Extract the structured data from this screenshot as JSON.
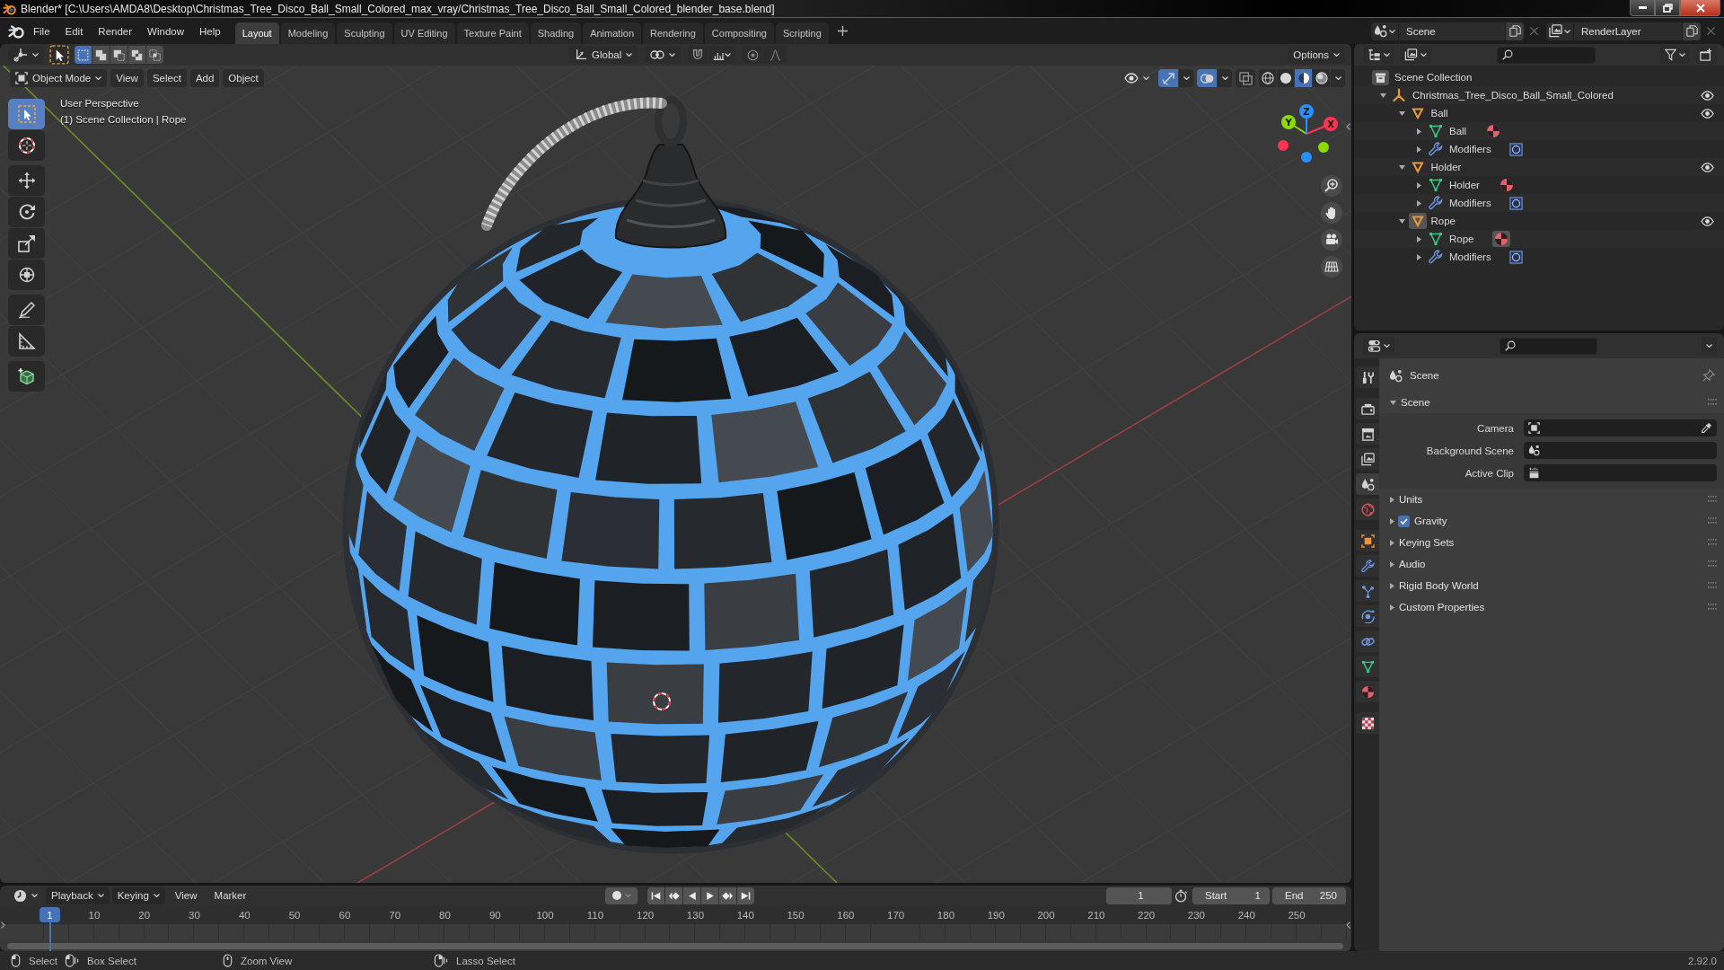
{
  "window": {
    "title": "Blender* [C:\\Users\\AMDA8\\Desktop\\Christmas_Tree_Disco_Ball_Small_Colored_max_vray/Christmas_Tree_Disco_Ball_Small_Colored_blender_base.blend]"
  },
  "menu": [
    "File",
    "Edit",
    "Render",
    "Window",
    "Help"
  ],
  "workspaces": [
    {
      "label": "Layout",
      "selected": true
    },
    {
      "label": "Modeling",
      "selected": false
    },
    {
      "label": "Sculpting",
      "selected": false
    },
    {
      "label": "UV Editing",
      "selected": false
    },
    {
      "label": "Texture Paint",
      "selected": false
    },
    {
      "label": "Shading",
      "selected": false
    },
    {
      "label": "Animation",
      "selected": false
    },
    {
      "label": "Rendering",
      "selected": false
    },
    {
      "label": "Compositing",
      "selected": false
    },
    {
      "label": "Scripting",
      "selected": false
    }
  ],
  "scene": {
    "value": "Scene"
  },
  "view_layer": {
    "value": "RenderLayer"
  },
  "tool_header": {
    "select_modes": [
      {
        "kind": "new",
        "selected": true
      },
      {
        "kind": "extend",
        "selected": false
      },
      {
        "kind": "subtract",
        "selected": false
      },
      {
        "kind": "invert",
        "selected": false
      },
      {
        "kind": "intersect",
        "selected": false
      }
    ],
    "orientation": "Global",
    "options": "Options"
  },
  "viewport": {
    "mode": "Object Mode",
    "menus": [
      "View",
      "Select",
      "Add",
      "Object"
    ],
    "toggles": [
      {
        "kind": "gizmos",
        "on": true
      },
      {
        "kind": "overlays",
        "on": true
      },
      {
        "kind": "xray",
        "on": false
      }
    ],
    "shading": [
      {
        "kind": "wireframe",
        "selected": false
      },
      {
        "kind": "solid",
        "selected": false
      },
      {
        "kind": "material",
        "selected": true
      },
      {
        "kind": "rendered",
        "selected": false
      }
    ],
    "info": [
      "User Perspective",
      "(1) Scene Collection | Rope"
    ],
    "tool_groups": [
      {
        "tools": [
          {
            "kind": "select-box",
            "selected": true
          },
          {
            "kind": "cursor",
            "selected": false
          }
        ]
      },
      {
        "tools": [
          {
            "kind": "move",
            "selected": false
          },
          {
            "kind": "rotate",
            "selected": false
          },
          {
            "kind": "scale",
            "selected": false
          },
          {
            "kind": "transform",
            "selected": false
          }
        ]
      },
      {
        "tools": [
          {
            "kind": "annotate",
            "selected": false
          },
          {
            "kind": "measure",
            "selected": false
          }
        ]
      },
      {
        "tools": [
          {
            "kind": "add-cube",
            "selected": false
          }
        ]
      }
    ],
    "gizmo_axes": [
      {
        "label": "X",
        "color": "#ff3352"
      },
      {
        "label": "Y",
        "color": "#8bdc00"
      },
      {
        "label": "Z",
        "color": "#2890ff"
      }
    ]
  },
  "outliner": {
    "root": "Scene Collection",
    "tree": [
      {
        "label": "Christmas_Tree_Disco_Ball_Small_Colored",
        "kind": "empty",
        "expanded": true,
        "visible": true,
        "active": false,
        "children": [
          {
            "label": "Ball",
            "kind": "object",
            "expanded": true,
            "visible": true,
            "active": false,
            "children": [
              {
                "label": "Ball",
                "kind": "mesh",
                "expanded": false,
                "active": false,
                "material_active": false
              },
              {
                "label": "Modifiers",
                "kind": "modifiers",
                "expanded": false,
                "active": false
              }
            ]
          },
          {
            "label": "Holder",
            "kind": "object",
            "expanded": true,
            "visible": true,
            "active": false,
            "children": [
              {
                "label": "Holder",
                "kind": "mesh",
                "expanded": false,
                "active": false,
                "material_active": false
              },
              {
                "label": "Modifiers",
                "kind": "modifiers",
                "expanded": false,
                "active": false
              }
            ]
          },
          {
            "label": "Rope",
            "kind": "object",
            "expanded": true,
            "visible": true,
            "active": true,
            "children": [
              {
                "label": "Rope",
                "kind": "mesh",
                "expanded": false,
                "active": false,
                "material_active": true
              },
              {
                "label": "Modifiers",
                "kind": "modifiers",
                "expanded": false,
                "active": false
              }
            ]
          }
        ]
      }
    ]
  },
  "properties": {
    "context": "Scene",
    "tab_groups": [
      {
        "tabs": [
          {
            "kind": "tool",
            "selected": false
          }
        ]
      },
      {
        "tabs": [
          {
            "kind": "render",
            "selected": false
          },
          {
            "kind": "output",
            "selected": false
          },
          {
            "kind": "view-layer",
            "selected": false
          },
          {
            "kind": "scene",
            "selected": true
          },
          {
            "kind": "world",
            "selected": false
          }
        ]
      },
      {
        "tabs": [
          {
            "kind": "object",
            "selected": false
          },
          {
            "kind": "modifiers",
            "selected": false
          },
          {
            "kind": "particles",
            "selected": false
          },
          {
            "kind": "physics",
            "selected": false
          },
          {
            "kind": "constraints",
            "selected": false
          },
          {
            "kind": "data",
            "selected": false
          },
          {
            "kind": "material",
            "selected": false
          }
        ]
      },
      {
        "tabs": [
          {
            "kind": "texture",
            "selected": false
          }
        ]
      }
    ],
    "panels": [
      {
        "title": "Scene",
        "kind": "plain",
        "expanded": true,
        "fields": [
          {
            "label": "Camera",
            "kind": "camera"
          },
          {
            "label": "Background Scene",
            "kind": "scene"
          },
          {
            "label": "Active Clip",
            "kind": "clip"
          }
        ]
      },
      {
        "title": "Units",
        "kind": "plain",
        "expanded": false
      },
      {
        "title": "Gravity",
        "kind": "checkbox",
        "checked": true,
        "expanded": false
      },
      {
        "title": "Keying Sets",
        "kind": "plain",
        "expanded": false
      },
      {
        "title": "Audio",
        "kind": "plain",
        "expanded": false
      },
      {
        "title": "Rigid Body World",
        "kind": "plain",
        "expanded": false
      },
      {
        "title": "Custom Properties",
        "kind": "plain",
        "expanded": false
      }
    ]
  },
  "timeline": {
    "menus": [
      {
        "label": "Playback",
        "kind": "dropdown"
      },
      {
        "label": "Keying",
        "kind": "dropdown"
      },
      {
        "label": "View",
        "kind": "menu"
      },
      {
        "label": "Marker",
        "kind": "menu"
      }
    ],
    "frame": "1",
    "start": {
      "label": "Start",
      "value": "1"
    },
    "end": {
      "label": "End",
      "value": "250"
    },
    "playhead": "1",
    "ticks": [
      "10",
      "20",
      "30",
      "40",
      "50",
      "60",
      "70",
      "80",
      "90",
      "100",
      "110",
      "120",
      "130",
      "140",
      "150",
      "160",
      "170",
      "180",
      "190",
      "200",
      "210",
      "220",
      "230",
      "240",
      "250"
    ]
  },
  "status": {
    "groups": [
      {
        "items": [
          {
            "kind": "mouse-left",
            "label": "Select"
          },
          {
            "kind": "mouse-left-drag",
            "label": "Box Select"
          }
        ]
      },
      {
        "items": [
          {
            "kind": "mouse-middle",
            "label": "Zoom View"
          }
        ]
      },
      {
        "items": [
          {
            "kind": "mouse-right-drag",
            "label": "Lasso Select"
          }
        ]
      }
    ],
    "version": "2.92.0"
  }
}
